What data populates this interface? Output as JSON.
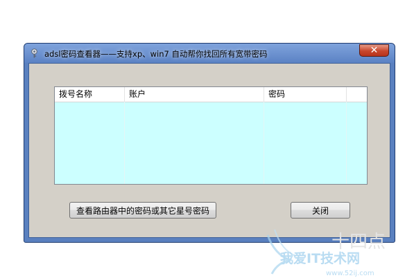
{
  "window": {
    "title": "adsl密码查看器——支持xp、win7 自动帮你找回所有宽带密码",
    "close_glyph": "✕"
  },
  "list": {
    "columns": [
      "拨号名称",
      "账户",
      "密码"
    ],
    "rows": []
  },
  "buttons": {
    "router_label": "查看路由器中的密码或其它星号密码",
    "close_label": "关闭"
  },
  "watermark": {
    "text_big": "十四点",
    "text_main": "我爱IT技术网",
    "text_url": "www.52ij.com"
  },
  "colors": {
    "title_bar": "#6a92d2",
    "list_background": "#ccffff",
    "dialog_background": "#d4d0c8",
    "close_button": "#c7462c"
  }
}
